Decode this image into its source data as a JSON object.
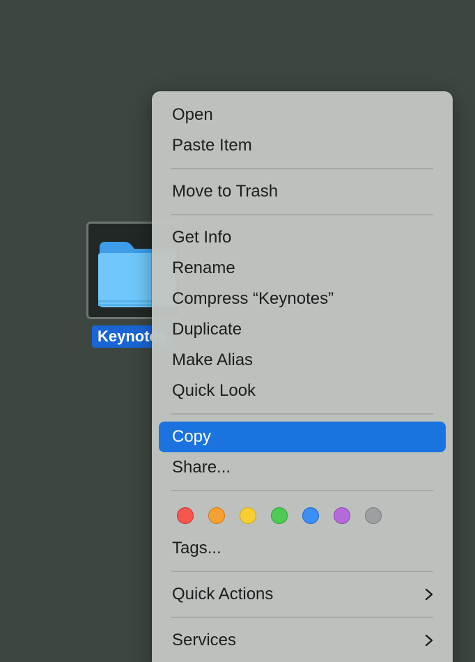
{
  "desktop": {
    "folder_name": "Keynotes"
  },
  "menu": {
    "groups": [
      [
        {
          "label": "Open"
        },
        {
          "label": "Paste Item"
        }
      ],
      [
        {
          "label": "Move to Trash"
        }
      ],
      [
        {
          "label": "Get Info"
        },
        {
          "label": "Rename"
        },
        {
          "label": "Compress “Keynotes”"
        },
        {
          "label": "Duplicate"
        },
        {
          "label": "Make Alias"
        },
        {
          "label": "Quick Look"
        }
      ],
      [
        {
          "label": "Copy",
          "highlighted": true
        },
        {
          "label": "Share..."
        }
      ]
    ],
    "tags": [
      {
        "name": "red",
        "color": "#f5564d",
        "border": "#c8322c"
      },
      {
        "name": "orange",
        "color": "#f7a032",
        "border": "#cf7a14"
      },
      {
        "name": "yellow",
        "color": "#f8cf33",
        "border": "#d1a811"
      },
      {
        "name": "green",
        "color": "#4ecb55",
        "border": "#2d9f34"
      },
      {
        "name": "blue",
        "color": "#3a8ef6",
        "border": "#1c67cf"
      },
      {
        "name": "purple",
        "color": "#b56ad9",
        "border": "#8d46b1"
      },
      {
        "name": "gray",
        "color": "#9d9fa1",
        "border": "#7a7c7e"
      }
    ],
    "tags_label": "Tags...",
    "quick_actions_label": "Quick Actions",
    "services_label": "Services",
    "accent_color": "#1a73df",
    "submenu_icon": "chevron-right-icon"
  }
}
